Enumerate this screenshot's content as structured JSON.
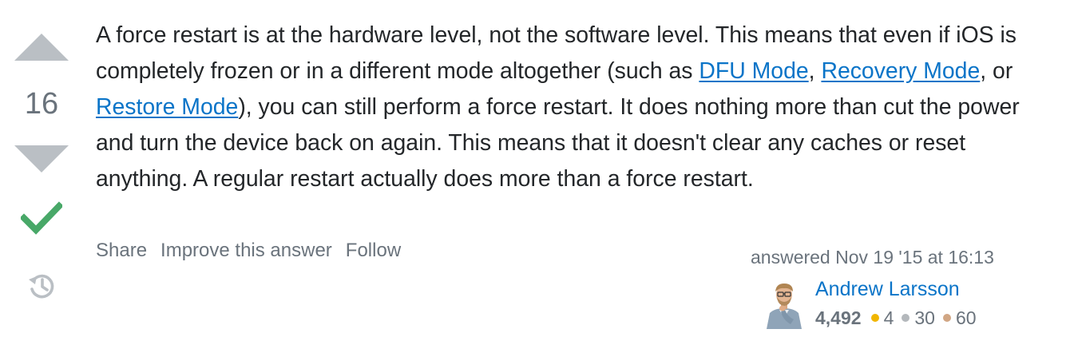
{
  "vote": {
    "count": "16"
  },
  "post": {
    "text_1": "A force restart is at the hardware level, not the software level. This means that even if iOS is completely frozen or in a different mode altogether (such as ",
    "link_dfu": "DFU Mode",
    "text_2": ", ",
    "link_recovery": "Recovery Mode",
    "text_3": ", or ",
    "link_restore": "Restore Mode",
    "text_4": "), you can still perform a force restart. It does nothing more than cut the power and turn the device back on again. This means that it doesn't clear any caches or reset anything. A regular restart actually does more than a force restart."
  },
  "menu": {
    "share": "Share",
    "improve": "Improve this answer",
    "follow": "Follow"
  },
  "user": {
    "action_time": "answered Nov 19 '15 at 16:13",
    "name": "Andrew Larsson",
    "reputation": "4,492",
    "gold": "4",
    "silver": "30",
    "bronze": "60"
  },
  "colors": {
    "link": "#0a74c8",
    "arrow": "#babfc4",
    "accepted": "#48a868",
    "muted": "#6a737c",
    "gold": "#f1b600",
    "silver": "#b4b8bc",
    "bronze": "#d1a684"
  },
  "icons": {
    "upvote": "upvote-arrow-icon",
    "downvote": "downvote-arrow-icon",
    "accepted": "accepted-checkmark-icon",
    "history": "history-clock-icon"
  }
}
